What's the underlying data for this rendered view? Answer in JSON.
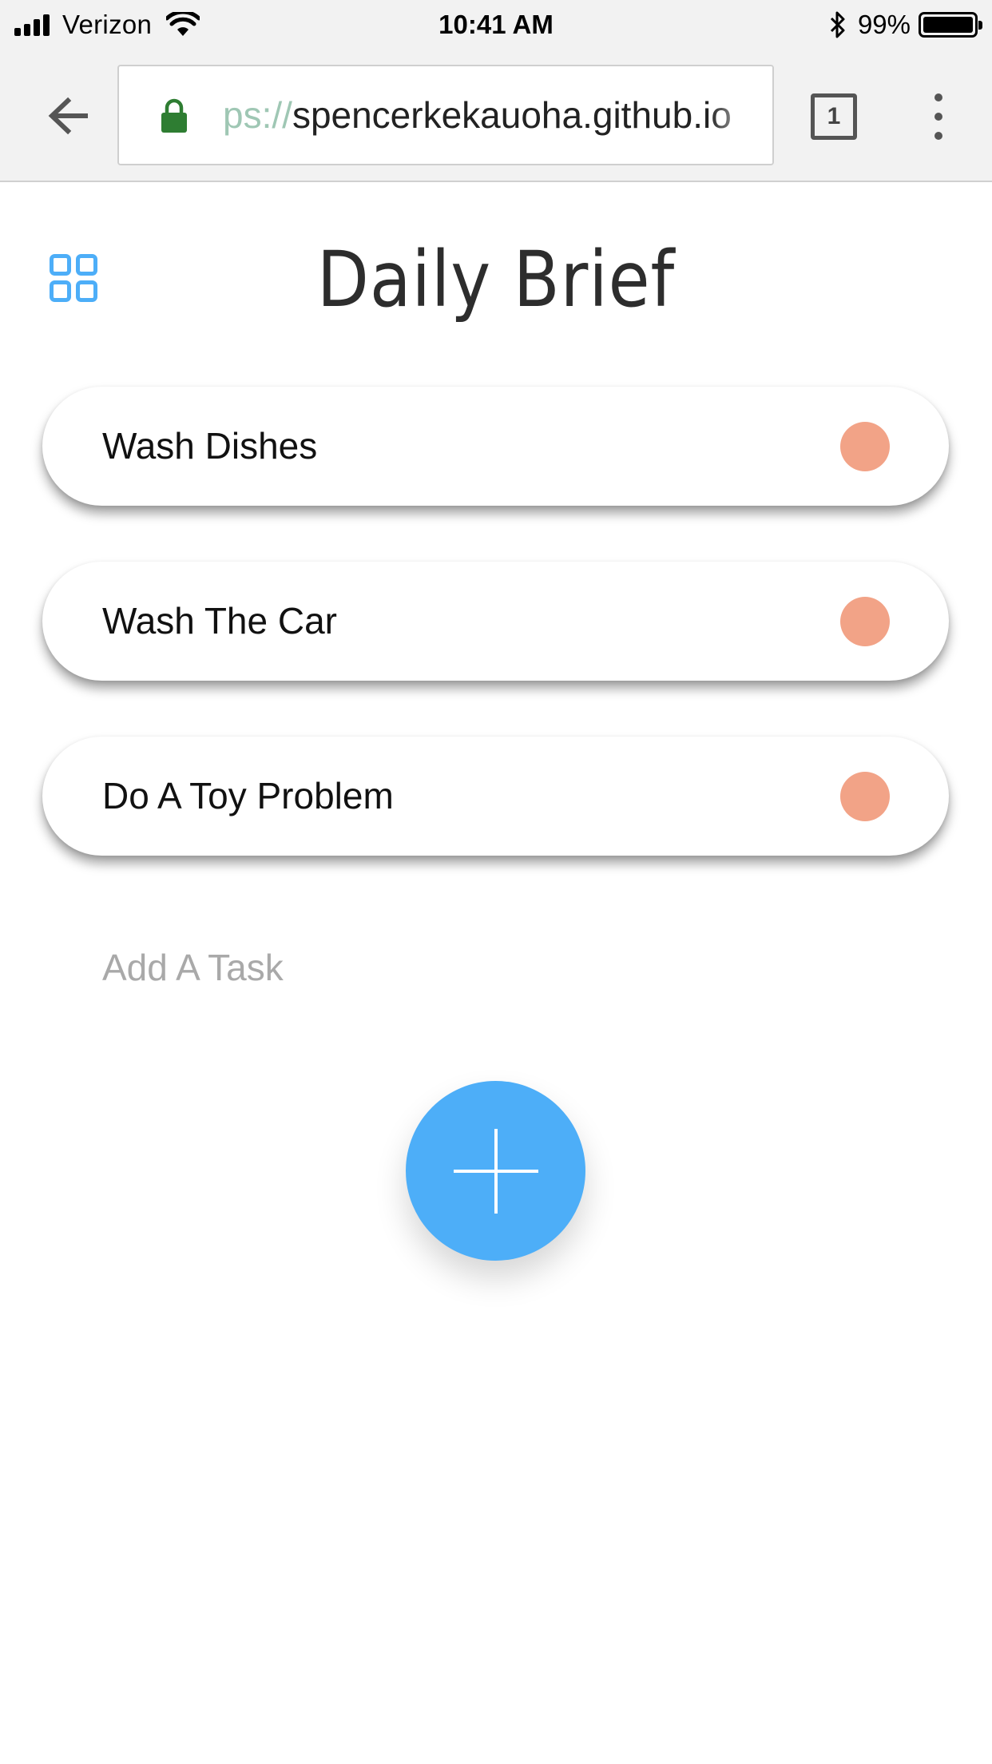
{
  "status_bar": {
    "carrier": "Verizon",
    "time": "10:41 AM",
    "battery_percent": "99%",
    "battery_level": 0.99,
    "signal_bars": 4
  },
  "browser": {
    "url_scheme": "ps://",
    "url_host": "spencerkekauoha.github.io",
    "tab_count": "1",
    "back_icon": "arrow-left-icon",
    "lock_icon": "lock-icon",
    "menu_icon": "more-vert-icon"
  },
  "app": {
    "title": "Daily Brief",
    "menu_icon": "grid-icon",
    "accent_color": "#4daef8",
    "status_dot_color": "#f2a387",
    "tasks": [
      {
        "label": "Wash Dishes"
      },
      {
        "label": "Wash The Car"
      },
      {
        "label": "Do A Toy Problem"
      }
    ],
    "add_task": {
      "placeholder": "Add A Task",
      "value": ""
    },
    "add_button_icon": "plus-icon"
  }
}
